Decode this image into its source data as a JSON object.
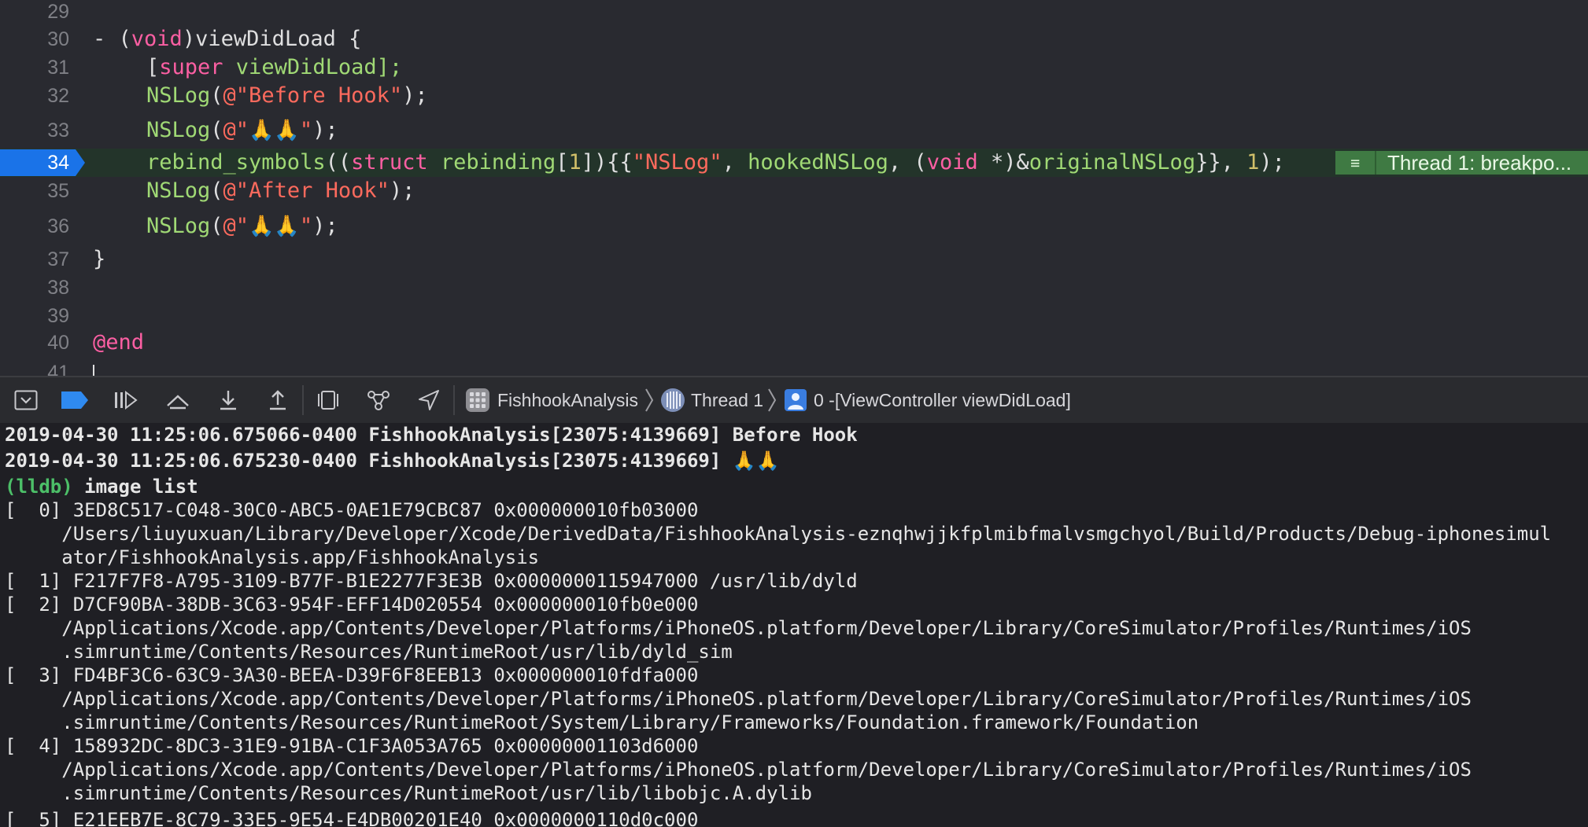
{
  "editor": {
    "line_numbers": [
      "29",
      "30",
      "31",
      "32",
      "33",
      "34",
      "35",
      "36",
      "37",
      "38",
      "39",
      "40",
      "41"
    ],
    "lines": {
      "l30": {
        "prefix": "- (",
        "kw": "void",
        "rest": ")viewDidLoad {"
      },
      "l31": {
        "open": "[",
        "kw": "super",
        "rest": " viewDidLoad];"
      },
      "l32": {
        "fn": "NSLog",
        "open": "(",
        "str": "@\"Before Hook\"",
        "close": ");"
      },
      "l33": {
        "fn": "NSLog",
        "open": "(",
        "str_open": "@\"",
        "emoji": "🙏🙏",
        "str_close": "\"",
        "close": ");"
      },
      "l34": {
        "fn": "rebind_symbols",
        "p1": "((",
        "kw1": "struct",
        "sp1": " ",
        "type1": "rebinding",
        "br_open": "[",
        "num1": "1",
        "br_close": "])",
        "brace": "{{",
        "str": "\"NSLog\"",
        "comma1": ", ",
        "id1": "hookedNSLog",
        "comma2": ", (",
        "kw2": "void",
        "ptr": " *)&",
        "id2": "originalNSLog",
        "close1": "}}, ",
        "num2": "1",
        "close2": ");"
      },
      "l35": {
        "fn": "NSLog",
        "open": "(",
        "str": "@\"After Hook\"",
        "close": ");"
      },
      "l36": {
        "fn": "NSLog",
        "open": "(",
        "str_open": "@\"",
        "emoji": "🙏🙏",
        "str_close": "\"",
        "close": ");"
      },
      "l37": {
        "text": "}"
      },
      "l40": {
        "text": "@end"
      }
    },
    "breakpoint_annotation": "Thread 1: breakpo..."
  },
  "toolbar": {
    "icons": [
      "hide-debug-area-icon",
      "breakpoints-toggle-icon",
      "continue-icon",
      "step-over-icon",
      "step-into-icon",
      "step-out-icon",
      "debug-view-hierarchy-icon",
      "memory-graph-icon",
      "simulate-location-icon"
    ],
    "breadcrumb": {
      "target": "FishhookAnalysis",
      "thread": "Thread 1",
      "frame": "0 -[ViewController viewDidLoad]"
    }
  },
  "console": {
    "log1": "2019-04-30 11:25:06.675066-0400 FishhookAnalysis[23075:4139669] Before Hook",
    "log2_prefix": "2019-04-30 11:25:06.675230-0400 FishhookAnalysis[23075:4139669] ",
    "log2_emoji": "🙏🙏",
    "prompt": "(lldb)",
    "command": " image list",
    "images": [
      "[  0] 3ED8C517-C048-30C0-ABC5-0AE1E79CBC87 0x000000010fb03000",
      "     /Users/liuyuxuan/Library/Developer/Xcode/DerivedData/FishhookAnalysis-eznqhwjjkfplmibfmalvsmgchyol/Build/Products/Debug-iphonesimul",
      "     ator/FishhookAnalysis.app/FishhookAnalysis",
      "[  1] F217F7F8-A795-3109-B77F-B1E2277F3E3B 0x0000000115947000 /usr/lib/dyld",
      "[  2] D7CF90BA-38DB-3C63-954F-EFF14D020554 0x000000010fb0e000",
      "     /Applications/Xcode.app/Contents/Developer/Platforms/iPhoneOS.platform/Developer/Library/CoreSimulator/Profiles/Runtimes/iOS",
      "     .simruntime/Contents/Resources/RuntimeRoot/usr/lib/dyld_sim",
      "[  3] FD4BF3C6-63C9-3A30-BEEA-D39F6F8EEB13 0x000000010fdfa000",
      "     /Applications/Xcode.app/Contents/Developer/Platforms/iPhoneOS.platform/Developer/Library/CoreSimulator/Profiles/Runtimes/iOS",
      "     .simruntime/Contents/Resources/RuntimeRoot/System/Library/Frameworks/Foundation.framework/Foundation",
      "[  4] 158932DC-8DC3-31E9-91BA-C1F3A053A765 0x00000001103d6000",
      "     /Applications/Xcode.app/Contents/Developer/Platforms/iPhoneOS.platform/Developer/Library/CoreSimulator/Profiles/Runtimes/iOS",
      "     .simruntime/Contents/Resources/RuntimeRoot/usr/lib/libobjc.A.dylib",
      "[  5] E21EEB7E-8C79-33E5-9E54-E4DB00201E40 0x0000000110d0c000"
    ]
  },
  "colors": {
    "editor_bg": "#292a30",
    "keyword": "#fc5fa3",
    "string": "#fc6a5d",
    "number": "#d0bf69",
    "identifier_green": "#a0d975",
    "breakpoint_blue": "#1a73e8",
    "thread_annotation": "#3f7a43",
    "lldb_prompt": "#4cbf68"
  }
}
